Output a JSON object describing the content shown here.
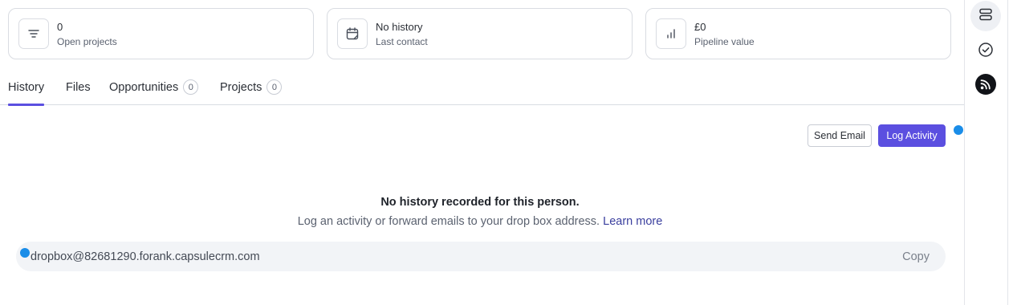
{
  "stats": [
    {
      "value": "0",
      "label": "Open projects",
      "icon": "list-lines-icon"
    },
    {
      "value": "No history",
      "label": "Last contact",
      "icon": "calendar-icon"
    },
    {
      "value": "£0",
      "label": "Pipeline value",
      "icon": "bar-chart-icon"
    }
  ],
  "tabs": [
    {
      "label": "History",
      "active": true
    },
    {
      "label": "Files"
    },
    {
      "label": "Opportunities",
      "count": "0"
    },
    {
      "label": "Projects",
      "count": "0"
    }
  ],
  "actions": {
    "send_email": "Send Email",
    "log_activity": "Log Activity"
  },
  "empty_state": {
    "title": "No history recorded for this person.",
    "description": "Log an activity or forward emails to your drop box address.",
    "link": "Learn more"
  },
  "dropbox": {
    "address": "dropbox@82681290.forank.capsulecrm.com",
    "copy_label": "Copy"
  },
  "sidebar": {
    "items": [
      {
        "icon": "stacked-rows-icon",
        "active": true
      },
      {
        "icon": "check-circle-icon"
      },
      {
        "icon": "feed-icon"
      }
    ]
  },
  "colors": {
    "accent": "#5b4fe0",
    "indicator_dot": "#1a8de8",
    "border": "#d9dce2"
  }
}
